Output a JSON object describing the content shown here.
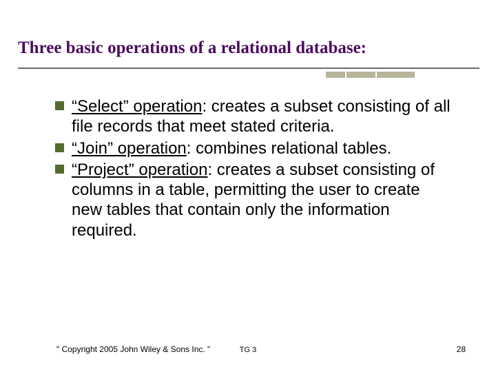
{
  "title": "Three basic operations of a relational database:",
  "bullets": [
    {
      "name": "“Select” operation",
      "desc": ": creates a subset consisting of all file records that meet stated criteria."
    },
    {
      "name": "“Join” operation",
      "desc": ": combines relational tables."
    },
    {
      "name": "“Project” operation",
      "desc": ": creates a subset consisting of  columns in a table, permitting the user to create new tables that contain only the information required."
    }
  ],
  "footer": {
    "copyright": "\" Copyright 2005 John Wiley & Sons Inc. \"",
    "chapter": "TG 3",
    "page": "28"
  }
}
